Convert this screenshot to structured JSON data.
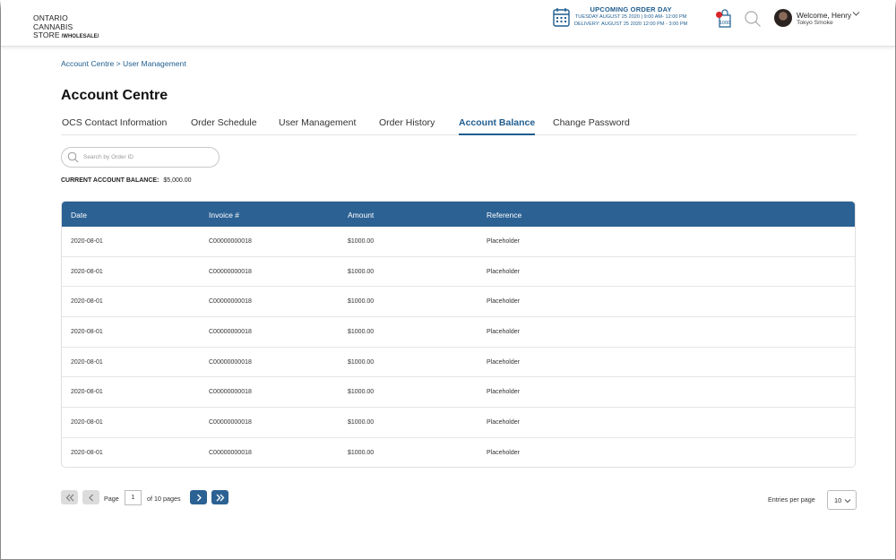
{
  "brand": {
    "line1": "ONTARIO",
    "line2": "CANNABIS",
    "line3": "STORE",
    "wholesale": "/WHOLESALE/"
  },
  "order_day": {
    "title": "UPCOMING ORDER DAY",
    "order_line": "TUESDAY AUGUST 25 2020 | 9:00 AM- 12:00 PM",
    "delivery_line": "DELIVERY: AUGUST 25 2020 12:00 PM - 3:00 PM"
  },
  "cart": {
    "amount": "1000"
  },
  "user": {
    "welcome": "Welcome, Henry",
    "store": "Tokyo Smoke"
  },
  "breadcrumb": "Account Centre > User Management",
  "page_title": "Account Centre",
  "tabs": [
    {
      "label": "OCS Contact Information"
    },
    {
      "label": "Order Schedule"
    },
    {
      "label": "User Management"
    },
    {
      "label": "Order History"
    },
    {
      "label": "Account Balance"
    },
    {
      "label": "Change Password"
    }
  ],
  "search": {
    "placeholder": "Search by Order ID"
  },
  "balance": {
    "label": "CURRENT ACCOUNT BALANCE:",
    "value": "$5,000.00"
  },
  "table": {
    "headers": [
      "Date",
      "Invoice #",
      "Amount",
      "Reference"
    ],
    "rows": [
      [
        "2020-08-01",
        "C00000000018",
        "$1000.00",
        "Placeholder"
      ],
      [
        "2020-08-01",
        "C00000000018",
        "$1000.00",
        "Placeholder"
      ],
      [
        "2020-08-01",
        "C00000000018",
        "$1000.00",
        "Placeholder"
      ],
      [
        "2020-08-01",
        "C00000000018",
        "$1000.00",
        "Placeholder"
      ],
      [
        "2020-08-01",
        "C00000000018",
        "$1000.00",
        "Placeholder"
      ],
      [
        "2020-08-01",
        "C00000000018",
        "$1000.00",
        "Placeholder"
      ],
      [
        "2020-08-01",
        "C00000000018",
        "$1000.00",
        "Placeholder"
      ],
      [
        "2020-08-01",
        "C00000000018",
        "$1000.00",
        "Placeholder"
      ]
    ]
  },
  "pagination": {
    "page_label": "Page",
    "current_page": "1",
    "of_pages": "of 10 pages",
    "entries_label": "Entries per page",
    "entries_value": "10"
  },
  "colors": {
    "primary": "#2b6193",
    "link": "#1f5d8f",
    "alert": "#d9252a"
  }
}
